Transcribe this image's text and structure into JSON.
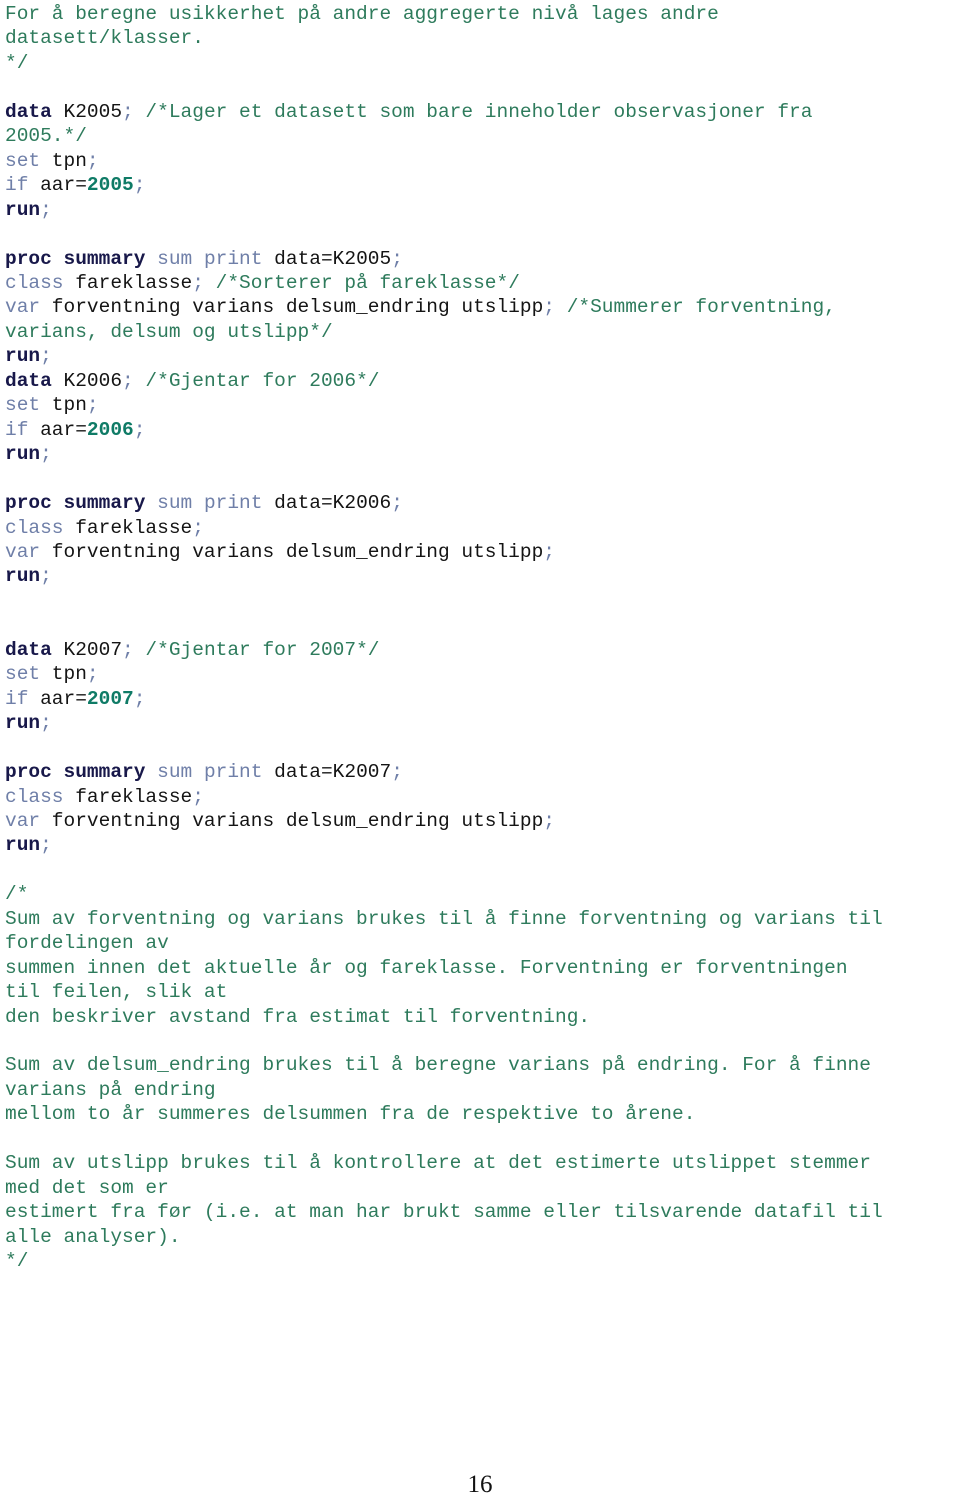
{
  "document": {
    "page_number": "16",
    "language": "SAS",
    "colors": {
      "comment": "#2e7b5c",
      "keyword": "#18184a",
      "keyword_secondary": "#6f7fa8",
      "identifier": "#141414",
      "number": "#0f7b66",
      "punctuation": "#6f7fa8",
      "background": "#ffffff"
    },
    "lines": [
      {
        "id": "l1",
        "tokens": [
          {
            "t": "For å beregne usikkerhet på andre aggregerte nivå lages andre",
            "c": "comment"
          }
        ]
      },
      {
        "id": "l2",
        "tokens": [
          {
            "t": "datasett/klasser.",
            "c": "comment"
          }
        ]
      },
      {
        "id": "l3",
        "tokens": [
          {
            "t": "*/",
            "c": "comment"
          }
        ]
      },
      {
        "id": "l4",
        "tokens": []
      },
      {
        "id": "l5",
        "tokens": [
          {
            "t": "data",
            "c": "kw"
          },
          {
            "t": " K2005",
            "c": "ident"
          },
          {
            "t": ";",
            "c": "punct"
          },
          {
            "t": " /*Lager et datasett som bare inneholder observasjoner fra",
            "c": "comment"
          }
        ]
      },
      {
        "id": "l6",
        "tokens": [
          {
            "t": "2005.*/",
            "c": "comment"
          }
        ]
      },
      {
        "id": "l7",
        "tokens": [
          {
            "t": "set",
            "c": "kw2"
          },
          {
            "t": " tpn",
            "c": "ident"
          },
          {
            "t": ";",
            "c": "punct"
          }
        ]
      },
      {
        "id": "l8",
        "tokens": [
          {
            "t": "if",
            "c": "kw2"
          },
          {
            "t": " aar=",
            "c": "ident"
          },
          {
            "t": "2005",
            "c": "num"
          },
          {
            "t": ";",
            "c": "punct"
          }
        ]
      },
      {
        "id": "l9",
        "tokens": [
          {
            "t": "run",
            "c": "kw"
          },
          {
            "t": ";",
            "c": "punct"
          }
        ]
      },
      {
        "id": "l10",
        "tokens": []
      },
      {
        "id": "l11",
        "tokens": [
          {
            "t": "proc summary",
            "c": "kw"
          },
          {
            "t": " sum print ",
            "c": "kw2"
          },
          {
            "t": "data=K2005",
            "c": "ident"
          },
          {
            "t": ";",
            "c": "punct"
          }
        ]
      },
      {
        "id": "l12",
        "tokens": [
          {
            "t": "class",
            "c": "kw2"
          },
          {
            "t": " fareklasse",
            "c": "ident"
          },
          {
            "t": ";",
            "c": "punct"
          },
          {
            "t": " /*Sorterer på fareklasse*/",
            "c": "comment"
          }
        ]
      },
      {
        "id": "l13",
        "tokens": [
          {
            "t": "var",
            "c": "kw2"
          },
          {
            "t": " forventning varians delsum_endring utslipp",
            "c": "ident"
          },
          {
            "t": ";",
            "c": "punct"
          },
          {
            "t": " /*Summerer forventning,",
            "c": "comment"
          }
        ]
      },
      {
        "id": "l14",
        "tokens": [
          {
            "t": "varians, delsum og utslipp*/",
            "c": "comment"
          }
        ]
      },
      {
        "id": "l15",
        "tokens": [
          {
            "t": "run",
            "c": "kw"
          },
          {
            "t": ";",
            "c": "punct"
          }
        ]
      },
      {
        "id": "l16",
        "tokens": [
          {
            "t": "data",
            "c": "kw"
          },
          {
            "t": " K2006",
            "c": "ident"
          },
          {
            "t": ";",
            "c": "punct"
          },
          {
            "t": " /*Gjentar for 2006*/",
            "c": "comment"
          }
        ]
      },
      {
        "id": "l17",
        "tokens": [
          {
            "t": "set",
            "c": "kw2"
          },
          {
            "t": " tpn",
            "c": "ident"
          },
          {
            "t": ";",
            "c": "punct"
          }
        ]
      },
      {
        "id": "l18",
        "tokens": [
          {
            "t": "if",
            "c": "kw2"
          },
          {
            "t": " aar=",
            "c": "ident"
          },
          {
            "t": "2006",
            "c": "num"
          },
          {
            "t": ";",
            "c": "punct"
          }
        ]
      },
      {
        "id": "l19",
        "tokens": [
          {
            "t": "run",
            "c": "kw"
          },
          {
            "t": ";",
            "c": "punct"
          }
        ]
      },
      {
        "id": "l20",
        "tokens": []
      },
      {
        "id": "l21",
        "tokens": [
          {
            "t": "proc summary",
            "c": "kw"
          },
          {
            "t": " sum print ",
            "c": "kw2"
          },
          {
            "t": "data=K2006",
            "c": "ident"
          },
          {
            "t": ";",
            "c": "punct"
          }
        ]
      },
      {
        "id": "l22",
        "tokens": [
          {
            "t": "class",
            "c": "kw2"
          },
          {
            "t": " fareklasse",
            "c": "ident"
          },
          {
            "t": ";",
            "c": "punct"
          }
        ]
      },
      {
        "id": "l23",
        "tokens": [
          {
            "t": "var",
            "c": "kw2"
          },
          {
            "t": " forventning varians delsum_endring utslipp",
            "c": "ident"
          },
          {
            "t": ";",
            "c": "punct"
          }
        ]
      },
      {
        "id": "l24",
        "tokens": [
          {
            "t": "run",
            "c": "kw"
          },
          {
            "t": ";",
            "c": "punct"
          }
        ]
      },
      {
        "id": "l25",
        "tokens": []
      },
      {
        "id": "l26",
        "tokens": []
      },
      {
        "id": "l27",
        "tokens": [
          {
            "t": "data",
            "c": "kw"
          },
          {
            "t": " K2007",
            "c": "ident"
          },
          {
            "t": ";",
            "c": "punct"
          },
          {
            "t": " /*Gjentar for 2007*/",
            "c": "comment"
          }
        ]
      },
      {
        "id": "l28",
        "tokens": [
          {
            "t": "set",
            "c": "kw2"
          },
          {
            "t": " tpn",
            "c": "ident"
          },
          {
            "t": ";",
            "c": "punct"
          }
        ]
      },
      {
        "id": "l29",
        "tokens": [
          {
            "t": "if",
            "c": "kw2"
          },
          {
            "t": " aar=",
            "c": "ident"
          },
          {
            "t": "2007",
            "c": "num"
          },
          {
            "t": ";",
            "c": "punct"
          }
        ]
      },
      {
        "id": "l30",
        "tokens": [
          {
            "t": "run",
            "c": "kw"
          },
          {
            "t": ";",
            "c": "punct"
          }
        ]
      },
      {
        "id": "l31",
        "tokens": []
      },
      {
        "id": "l32",
        "tokens": [
          {
            "t": "proc summary",
            "c": "kw"
          },
          {
            "t": " sum print ",
            "c": "kw2"
          },
          {
            "t": "data=K2007",
            "c": "ident"
          },
          {
            "t": ";",
            "c": "punct"
          }
        ]
      },
      {
        "id": "l33",
        "tokens": [
          {
            "t": "class",
            "c": "kw2"
          },
          {
            "t": " fareklasse",
            "c": "ident"
          },
          {
            "t": ";",
            "c": "punct"
          }
        ]
      },
      {
        "id": "l34",
        "tokens": [
          {
            "t": "var",
            "c": "kw2"
          },
          {
            "t": " forventning varians delsum_endring utslipp",
            "c": "ident"
          },
          {
            "t": ";",
            "c": "punct"
          }
        ]
      },
      {
        "id": "l35",
        "tokens": [
          {
            "t": "run",
            "c": "kw"
          },
          {
            "t": ";",
            "c": "punct"
          }
        ]
      },
      {
        "id": "l36",
        "tokens": []
      },
      {
        "id": "l37",
        "tokens": [
          {
            "t": "/*",
            "c": "comment"
          }
        ]
      },
      {
        "id": "l38",
        "tokens": [
          {
            "t": "Sum av forventning og varians brukes til å finne forventning og varians til",
            "c": "comment"
          }
        ]
      },
      {
        "id": "l39",
        "tokens": [
          {
            "t": "fordelingen av",
            "c": "comment"
          }
        ]
      },
      {
        "id": "l40",
        "tokens": [
          {
            "t": "summen innen det aktuelle år og fareklasse. Forventning er forventningen",
            "c": "comment"
          }
        ]
      },
      {
        "id": "l41",
        "tokens": [
          {
            "t": "til feilen, slik at",
            "c": "comment"
          }
        ]
      },
      {
        "id": "l42",
        "tokens": [
          {
            "t": "den beskriver avstand fra estimat til forventning.",
            "c": "comment"
          }
        ]
      },
      {
        "id": "l43",
        "tokens": []
      },
      {
        "id": "l44",
        "tokens": [
          {
            "t": "Sum av delsum_endring brukes til å beregne varians på endring. For å finne",
            "c": "comment"
          }
        ]
      },
      {
        "id": "l45",
        "tokens": [
          {
            "t": "varians på endring",
            "c": "comment"
          }
        ]
      },
      {
        "id": "l46",
        "tokens": [
          {
            "t": "mellom to år summeres delsummen fra de respektive to årene.",
            "c": "comment"
          }
        ]
      },
      {
        "id": "l47",
        "tokens": []
      },
      {
        "id": "l48",
        "tokens": [
          {
            "t": "Sum av utslipp brukes til å kontrollere at det estimerte utslippet stemmer",
            "c": "comment"
          }
        ]
      },
      {
        "id": "l49",
        "tokens": [
          {
            "t": "med det som er",
            "c": "comment"
          }
        ]
      },
      {
        "id": "l50",
        "tokens": [
          {
            "t": "estimert fra før (i.e. at man har brukt samme eller tilsvarende datafil til",
            "c": "comment"
          }
        ]
      },
      {
        "id": "l51",
        "tokens": [
          {
            "t": "alle analyser).",
            "c": "comment"
          }
        ]
      },
      {
        "id": "l52",
        "tokens": [
          {
            "t": "*/",
            "c": "comment"
          }
        ]
      }
    ]
  }
}
